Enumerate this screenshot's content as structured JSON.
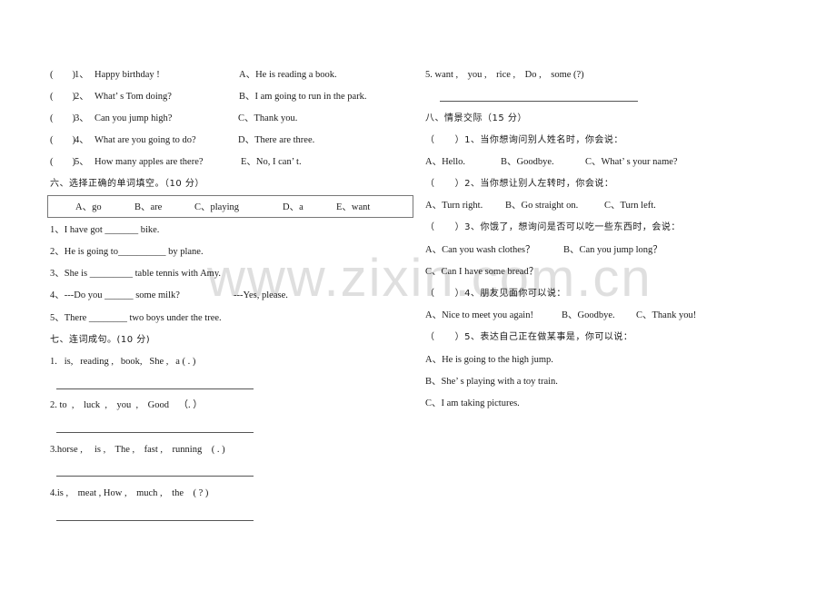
{
  "matching": {
    "items": [
      {
        "bracket": "(        )",
        "num": "1、",
        "question": "Happy birthday !",
        "answer": "A、He is reading a book."
      },
      {
        "bracket": "(        )",
        "num": "2、",
        "question": "What’ s Tom doing?",
        "answer": "B、I am going to run in the park."
      },
      {
        "bracket": "(        )",
        "num": "3、",
        "question": "Can you jump high?",
        "answer": "C、Thank you."
      },
      {
        "bracket": "(        )",
        "num": "4、",
        "question": "What are you going to do?",
        "answer": "D、There are three."
      },
      {
        "bracket": "(        )",
        "num": "5、",
        "question": "How many apples are there?",
        "answer": "E、No, I can’ t."
      }
    ]
  },
  "section6": {
    "title": "六、选择正确的单词填空。（10 分）",
    "options": [
      "A、go",
      "B、are",
      "C、playing",
      "D、a",
      "E、want"
    ],
    "questions": [
      "1、I have got _______ bike.",
      "2、He is going to__________ by plane.",
      "3、She is _________ table tennis with Amy.",
      "4、---Do you ______ some milk?",
      "5、There ________ two boys under the tree."
    ],
    "q4_reply": "---Yes, please."
  },
  "section7": {
    "title": "七、连词成句。(10 分)",
    "items": [
      "1.   is,   reading ,   book,   She ,   a ( . )",
      "2. to  ,    luck  ,    you  ,    Good    （. ）",
      "3.horse ,     is ,    The ,    fast ,    running    ( . )",
      "4.is ,    meat , How ,    much ,    the    ( ? )",
      "5. want ,    you ,    rice ,    Do ,    some (?)"
    ]
  },
  "section8": {
    "title": "八、情景交际（15 分）",
    "questions": [
      {
        "prompt": "（      ）1、当你想询问别人姓名时，你会说：",
        "options": [
          "A、Hello.",
          "B、Goodbye.",
          "C、What’ s your name?"
        ]
      },
      {
        "prompt": "（      ）2、当你想让别人左转时，你会说：",
        "options": [
          "A、Turn right.",
          "B、Go straight on.",
          "C、Turn left."
        ]
      },
      {
        "prompt": "（      ）3、你饿了，想询问是否可以吃一些东西时，会说：",
        "options": [
          "A、Can you wash clothes？",
          "B、Can you jump long？",
          "C、Can I have some bread？"
        ]
      },
      {
        "prompt": "（      ）4、朋友见面你可以说：",
        "options": [
          "A、Nice to meet you again!",
          "B、Goodbye.",
          "C、Thank you!"
        ]
      },
      {
        "prompt": "（      ）5、表达自己正在做某事是，你可以说：",
        "options": [
          "A、He is going to the high jump.",
          "B、She’ s playing with a toy train.",
          "C、I am taking pictures."
        ]
      }
    ]
  },
  "watermark": "www.zixin.com.cn"
}
